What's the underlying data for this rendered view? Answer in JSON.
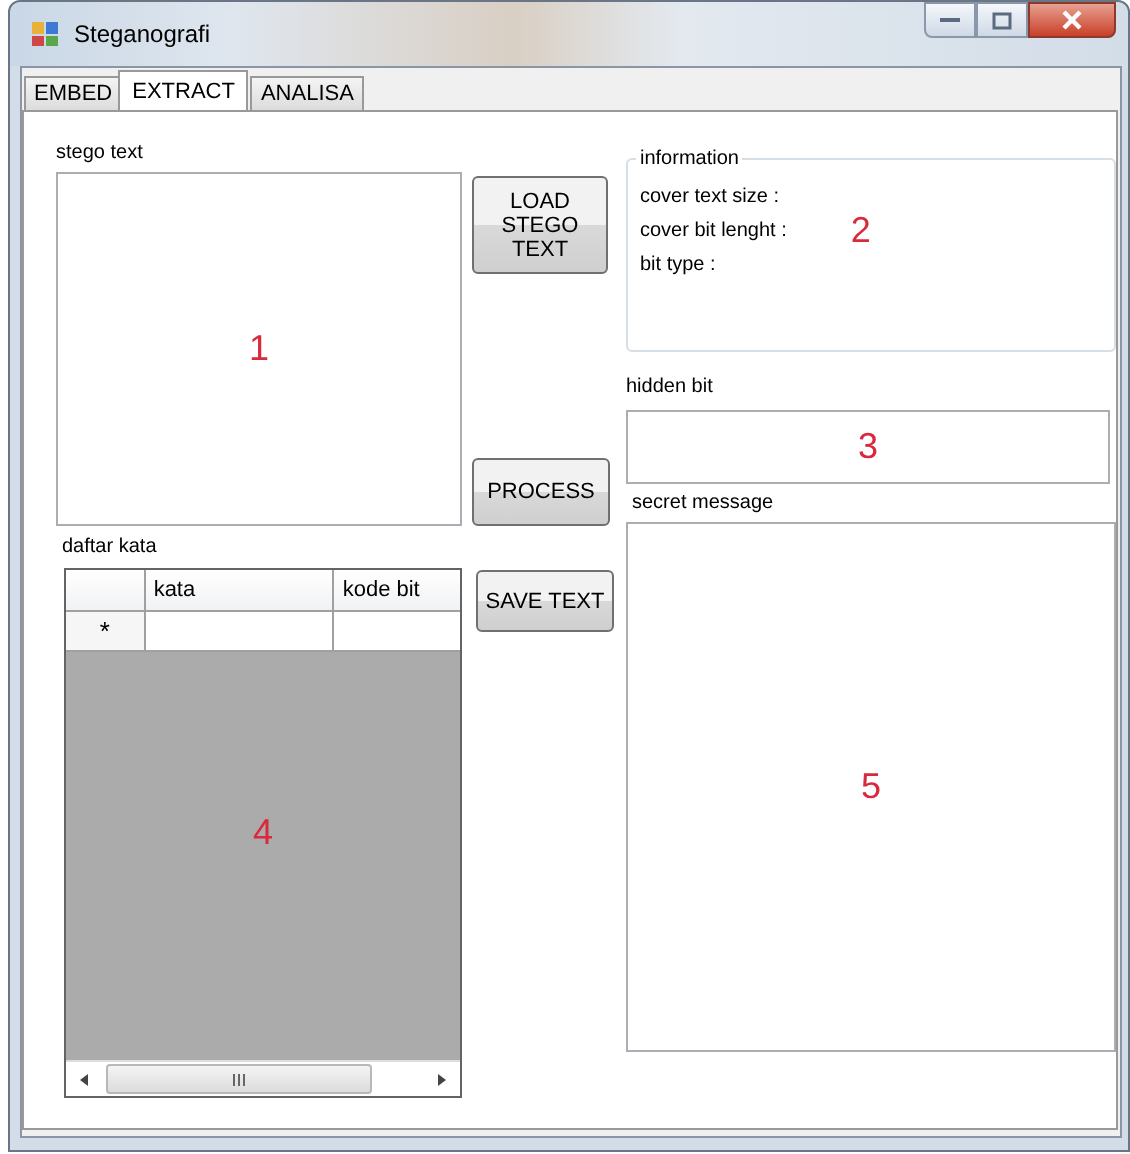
{
  "window": {
    "title": "Steganografi"
  },
  "tabs": [
    {
      "label": "EMBED",
      "selected": false
    },
    {
      "label": "EXTRACT",
      "selected": true
    },
    {
      "label": "ANALISA",
      "selected": false
    }
  ],
  "stego_text": {
    "label": "stego text",
    "annotation": "1"
  },
  "buttons": [
    "LOAD STEGO TEXT",
    "PROCESS",
    "SAVE TEXT"
  ],
  "information": {
    "legend": "information",
    "lines": [
      "cover text size :",
      "cover bit lenght :",
      "bit type :"
    ],
    "annotation": "2"
  },
  "hidden_bit": {
    "label": "hidden bit",
    "annotation": "3"
  },
  "daftar_kata": {
    "label": "daftar kata",
    "columns": [
      "kata",
      "kode bit"
    ],
    "new_row_marker": "*",
    "annotation": "4"
  },
  "secret_message": {
    "label": "secret message",
    "annotation": "5"
  }
}
